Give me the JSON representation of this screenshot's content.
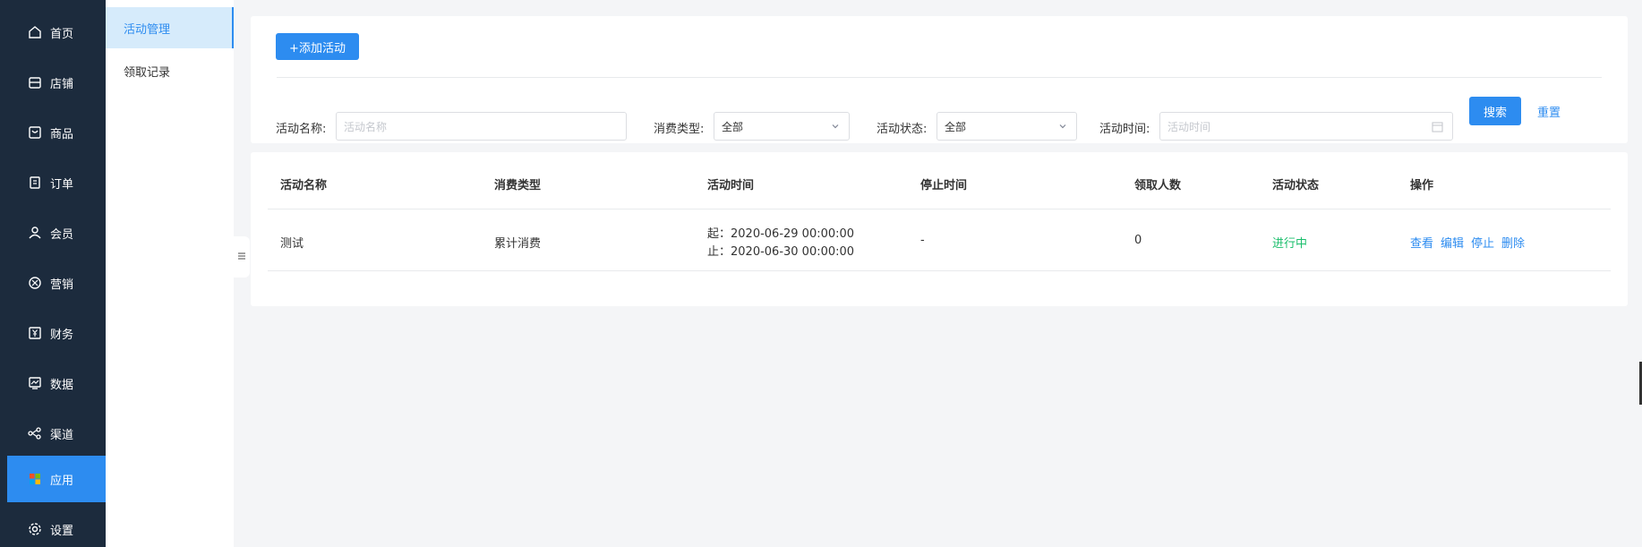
{
  "sidebar": {
    "items": [
      {
        "label": "首页",
        "icon": "home-icon"
      },
      {
        "label": "店铺",
        "icon": "store-icon"
      },
      {
        "label": "商品",
        "icon": "goods-icon"
      },
      {
        "label": "订单",
        "icon": "order-icon"
      },
      {
        "label": "会员",
        "icon": "member-icon"
      },
      {
        "label": "营销",
        "icon": "marketing-icon"
      },
      {
        "label": "财务",
        "icon": "finance-icon"
      },
      {
        "label": "数据",
        "icon": "data-icon"
      },
      {
        "label": "渠道",
        "icon": "channel-icon"
      },
      {
        "label": "应用",
        "icon": "apps-icon",
        "active": true
      },
      {
        "label": "设置",
        "icon": "settings-icon"
      }
    ]
  },
  "subnav": {
    "items": [
      {
        "label": "活动管理",
        "active": true
      },
      {
        "label": "领取记录"
      }
    ]
  },
  "toolbar": {
    "add_label": "+添加活动"
  },
  "filters": {
    "name_label": "活动名称:",
    "name_placeholder": "活动名称",
    "type_label": "消费类型:",
    "type_value": "全部",
    "status_label": "活动状态:",
    "status_value": "全部",
    "time_label": "活动时间:",
    "time_placeholder": "活动时间",
    "search_label": "搜索",
    "reset_label": "重置"
  },
  "table": {
    "columns": [
      "活动名称",
      "消费类型",
      "活动时间",
      "停止时间",
      "领取人数",
      "活动状态",
      "操作"
    ],
    "rows": [
      {
        "name": "测试",
        "type": "累计消费",
        "start": "起：2020-06-29 00:00:00",
        "end": "止：2020-06-30 00:00:00",
        "stop_time": "-",
        "count": "0",
        "status": "进行中",
        "actions": [
          "查看",
          "编辑",
          "停止",
          "删除"
        ]
      }
    ]
  },
  "colors": {
    "accent": "#2d8cf0",
    "sidebar_bg": "#1c2b3d",
    "status_running": "#19be6b"
  }
}
